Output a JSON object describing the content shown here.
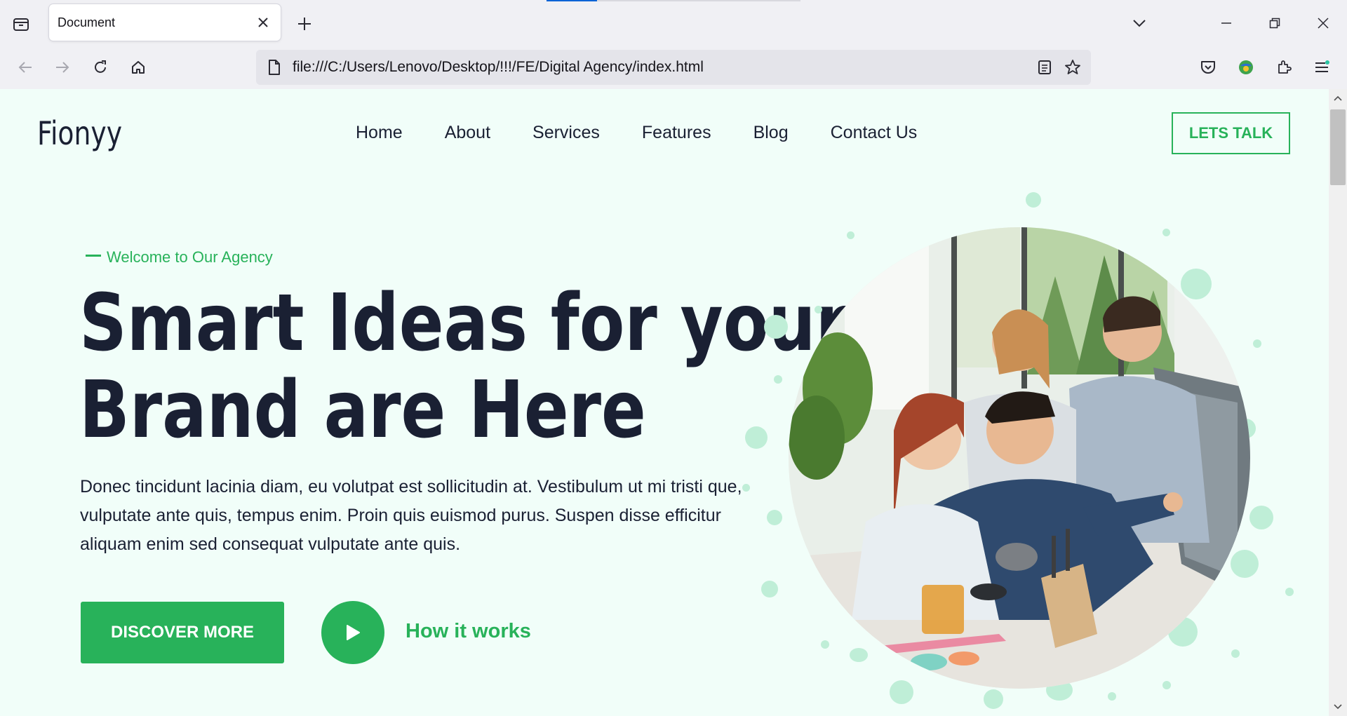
{
  "browser": {
    "tab_title": "Document",
    "url": "file:///C:/Users/Lenovo/Desktop/!!!/FE/Digital Agency/index.html"
  },
  "site": {
    "logo": "Fionyy",
    "nav": [
      "Home",
      "About",
      "Services",
      "Features",
      "Blog",
      "Contact Us"
    ],
    "cta": "LETS TALK"
  },
  "hero": {
    "tagline": "Welcome to Our Agency",
    "headline_line1": "Smart Ideas for your",
    "headline_line2": "Brand are Here",
    "description": "Donec tincidunt lacinia diam, eu volutpat est sollicitudin at. Vestibulum ut mi tristi que, vulputate ante quis, tempus enim. Proin quis euismod purus. Suspen disse efficitur aliquam enim sed consequat vulputate ante quis.",
    "primary_button": "DISCOVER MORE",
    "secondary_link": "How it works"
  },
  "colors": {
    "accent": "#28b25a",
    "page_bg": "#f1fef9",
    "text_dark": "#1a2033",
    "bubble": "#bfeed7"
  }
}
